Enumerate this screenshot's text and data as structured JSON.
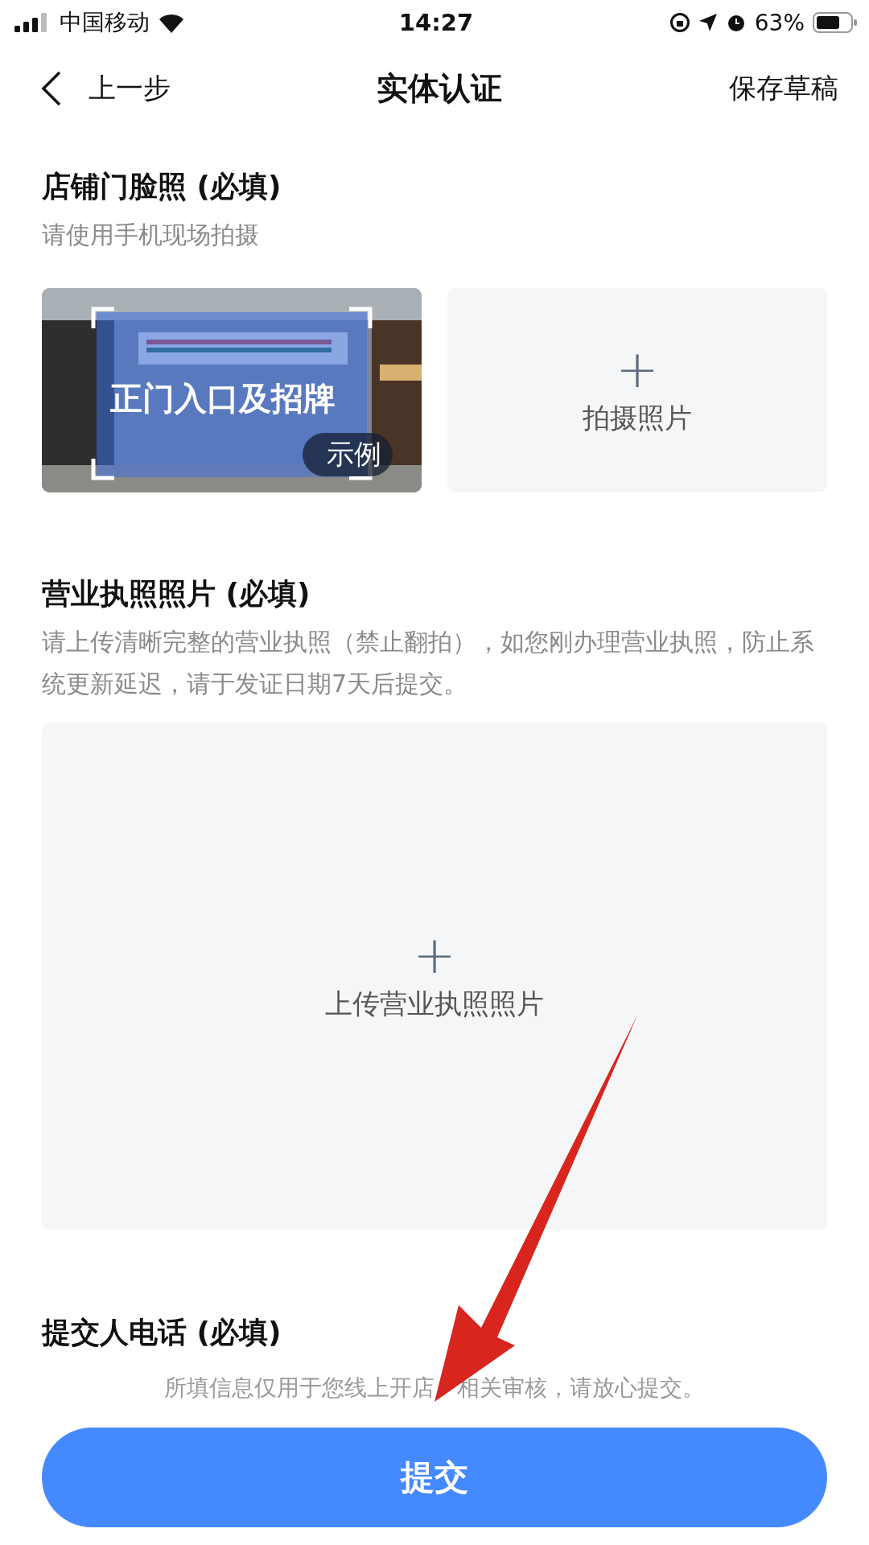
{
  "status_bar": {
    "carrier": "中国移动",
    "time": "14:27",
    "battery": "63%"
  },
  "nav": {
    "back": "上一步",
    "title": "实体认证",
    "action": "保存草稿"
  },
  "sections": [
    {
      "title": "店铺门脸照 (必填)",
      "hint": "请使用手机现场拍摄",
      "example": {
        "caption": "正门入口及招牌",
        "badge": "示例"
      },
      "upload": {
        "plus": "+",
        "label": "拍摄照片"
      }
    },
    {
      "kind": "large",
      "title": "营业执照照片 (必填)",
      "hint": "请上传清晰完整的营业执照（禁止翻拍），如您刚办理营业执照，防止系统更新延迟，请于发证日期7天后提交。",
      "upload": {
        "plus": "+",
        "label": "上传营业执照照片"
      }
    },
    {
      "kind": "heading",
      "title": "提交人电话 (必填)"
    }
  ],
  "footer": {
    "notice": [
      "所填信息仅用于您线上开店",
      "相关审核，请放心提交。"
    ],
    "submit": "提交"
  }
}
